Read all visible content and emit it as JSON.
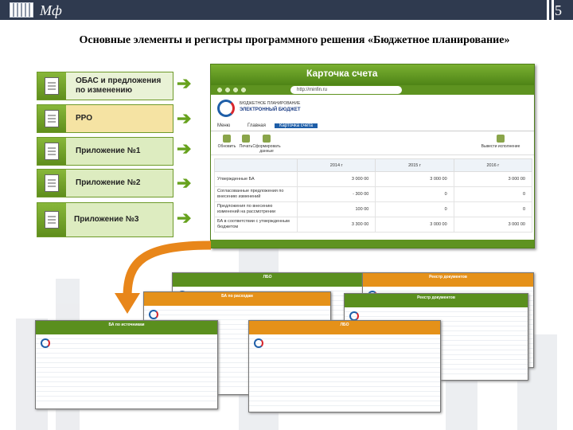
{
  "header": {
    "brand": "Мф",
    "page_number": "5"
  },
  "slide_title": "Основные элементы и регистры программного решения «Бюджетное планирование»",
  "menu_items": [
    {
      "label": "ОБАС и предложения по изменению"
    },
    {
      "label": "РРО"
    },
    {
      "label": "Приложение №1"
    },
    {
      "label": "Приложение №2"
    },
    {
      "label": "Приложение №3"
    }
  ],
  "main_window": {
    "title": "Карточка счета",
    "url": "http://minfin.ru",
    "logo_line1": "БЮДЖЕТНОЕ ПЛАНИРОВАНИЕ",
    "logo_line2": "ЭЛЕКТРОННЫЙ БЮДЖЕТ",
    "nav": {
      "menu": "Меню",
      "home": "Главная",
      "active_tab": "Карточка счета"
    },
    "tools": [
      "Обновить",
      "Печать",
      "Сформировать данные",
      "Вывести исполнение"
    ],
    "table": {
      "columns": [
        "",
        "2014 г",
        "2015 г",
        "2016 г"
      ],
      "rows": [
        {
          "label": "Утвержденные БА",
          "values": [
            "3 000 00",
            "3 000 00",
            "3 000 00"
          ]
        },
        {
          "label": "Согласованные предложения по внесению изменений",
          "values": [
            "- 300 00",
            "0",
            "0"
          ]
        },
        {
          "label": "Предложения по внесению изменений на рассмотрении",
          "values": [
            "100 00",
            "0",
            "0"
          ]
        },
        {
          "label": "БА в соответствии с утвержденным бюджетом",
          "values": [
            "3 300 00",
            "3 000 00",
            "3 000 00"
          ]
        }
      ]
    }
  },
  "thumbnails": [
    {
      "title": "ЛБО",
      "theme": "green"
    },
    {
      "title": "Реестр документов",
      "theme": "orange"
    },
    {
      "title": "БА по расходам",
      "theme": "orange"
    },
    {
      "title": "Реестр документов",
      "theme": "green"
    },
    {
      "title": "БА по источникам",
      "theme": "green"
    },
    {
      "title": "ЛБО",
      "theme": "orange"
    }
  ],
  "colors": {
    "accent_green": "#67a21e",
    "arrow_orange": "#e8861a",
    "header_bg": "#2f3a4f"
  }
}
